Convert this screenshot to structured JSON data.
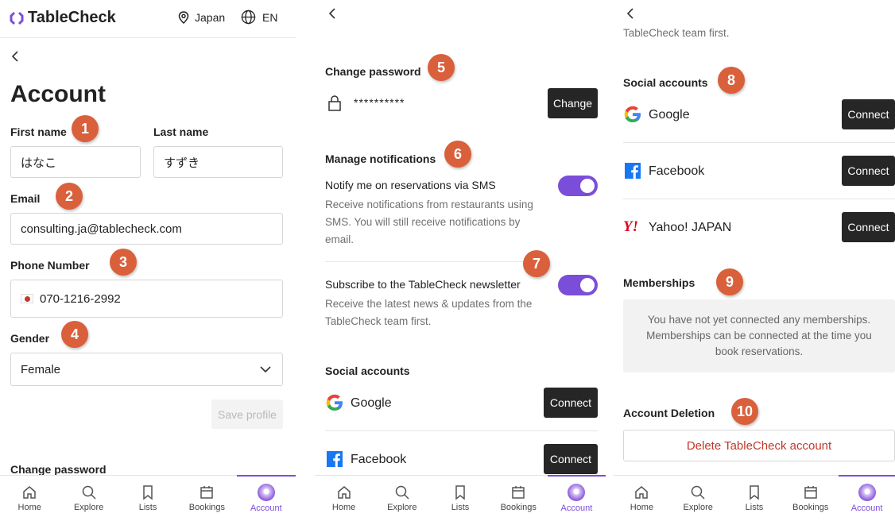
{
  "header": {
    "brand": "TableCheck",
    "region": "Japan",
    "language": "EN"
  },
  "account": {
    "title": "Account",
    "first_name_label": "First name",
    "first_name_value": "はなこ",
    "last_name_label": "Last name",
    "last_name_value": "すずき",
    "email_label": "Email",
    "email_value": "consulting.ja@tablecheck.com",
    "phone_label": "Phone Number",
    "phone_value": "070-1216-2992",
    "gender_label": "Gender",
    "gender_value": "Female",
    "save_label": "Save profile"
  },
  "password": {
    "heading": "Change password",
    "masked": "**********",
    "change_label": "Change"
  },
  "notifications": {
    "heading": "Manage notifications",
    "sms_title": "Notify me on reservations via SMS",
    "sms_desc": "Receive notifications from restaurants using SMS. You will still receive notifications by email.",
    "sms_on": true,
    "newsletter_title": "Subscribe to the TableCheck newsletter",
    "newsletter_desc": "Receive the latest news & updates from the TableCheck team first.",
    "newsletter_desc_cut": "TableCheck team first.",
    "newsletter_on": true
  },
  "social": {
    "heading": "Social accounts",
    "connect_label": "Connect",
    "providers": [
      {
        "name": "Google",
        "icon": "google-icon"
      },
      {
        "name": "Facebook",
        "icon": "facebook-icon"
      },
      {
        "name": "Yahoo! JAPAN",
        "icon": "yahoo-japan-icon"
      }
    ]
  },
  "memberships": {
    "heading": "Memberships",
    "empty_text": "You have not yet connected any memberships. Memberships can be connected at the time you book reservations."
  },
  "deletion": {
    "heading": "Account Deletion",
    "delete_label": "Delete TableCheck account"
  },
  "nav": {
    "home": "Home",
    "explore": "Explore",
    "lists": "Lists",
    "bookings": "Bookings",
    "account": "Account"
  },
  "badges": [
    "1",
    "2",
    "3",
    "4",
    "5",
    "6",
    "7",
    "8",
    "9",
    "10"
  ],
  "colors": {
    "accent": "#7b4ed9",
    "badge": "#d9603b",
    "danger": "#c0392b",
    "dark_button": "#262626"
  }
}
